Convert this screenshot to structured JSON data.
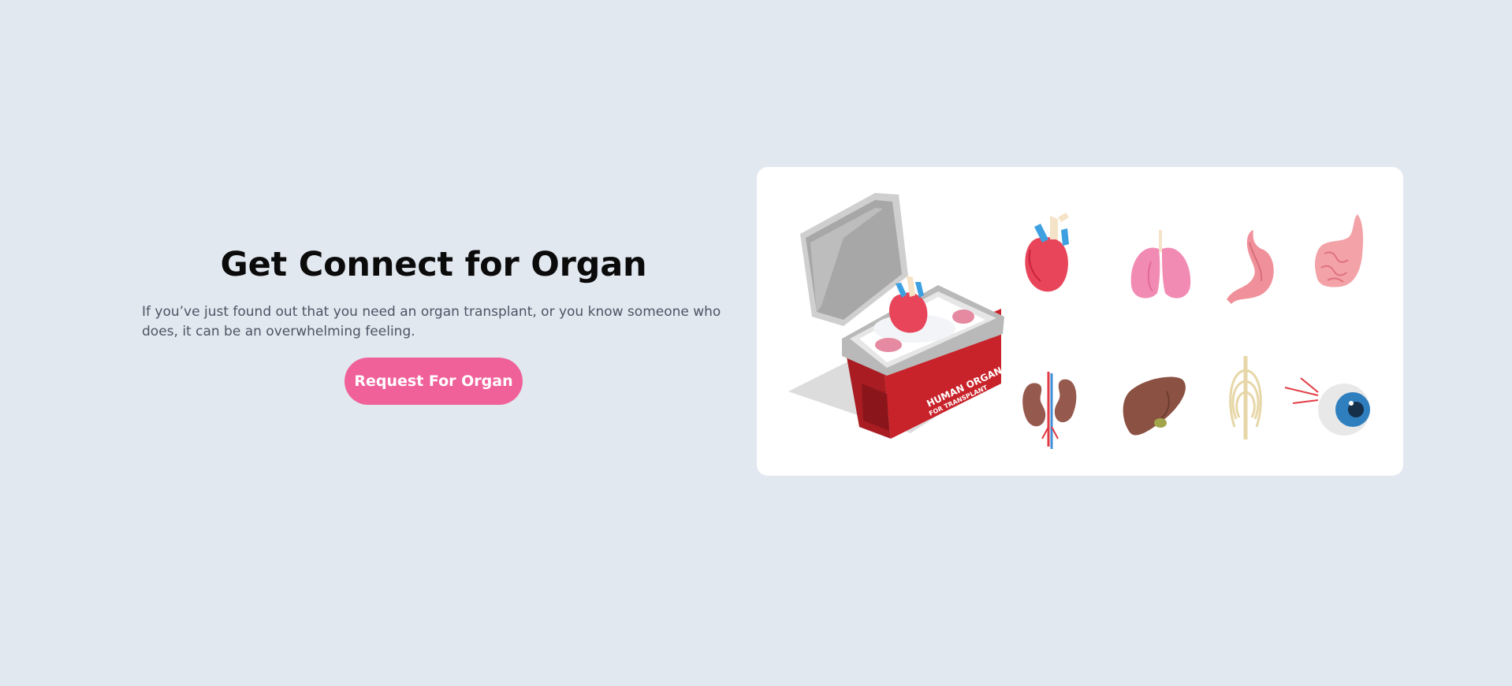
{
  "hero": {
    "title": "Get Connect for Organ",
    "description": "If you’ve just found out that you need an organ transplant, or you know someone who does, it can be an overwhelming feeling.",
    "cta_label": "Request For Organ"
  },
  "illustration": {
    "box_label_line1": "HUMAN ORGAN",
    "box_label_line2": "FOR TRANSPLANT",
    "organ_icons": [
      "heart-icon",
      "lungs-icon",
      "stomach-icon",
      "intestine-icon",
      "kidneys-icon",
      "liver-icon",
      "ribcage-icon",
      "eye-icon"
    ]
  },
  "colors": {
    "background": "#e2e8f0",
    "accent": "#f0619a",
    "box_red": "#c8232a"
  }
}
